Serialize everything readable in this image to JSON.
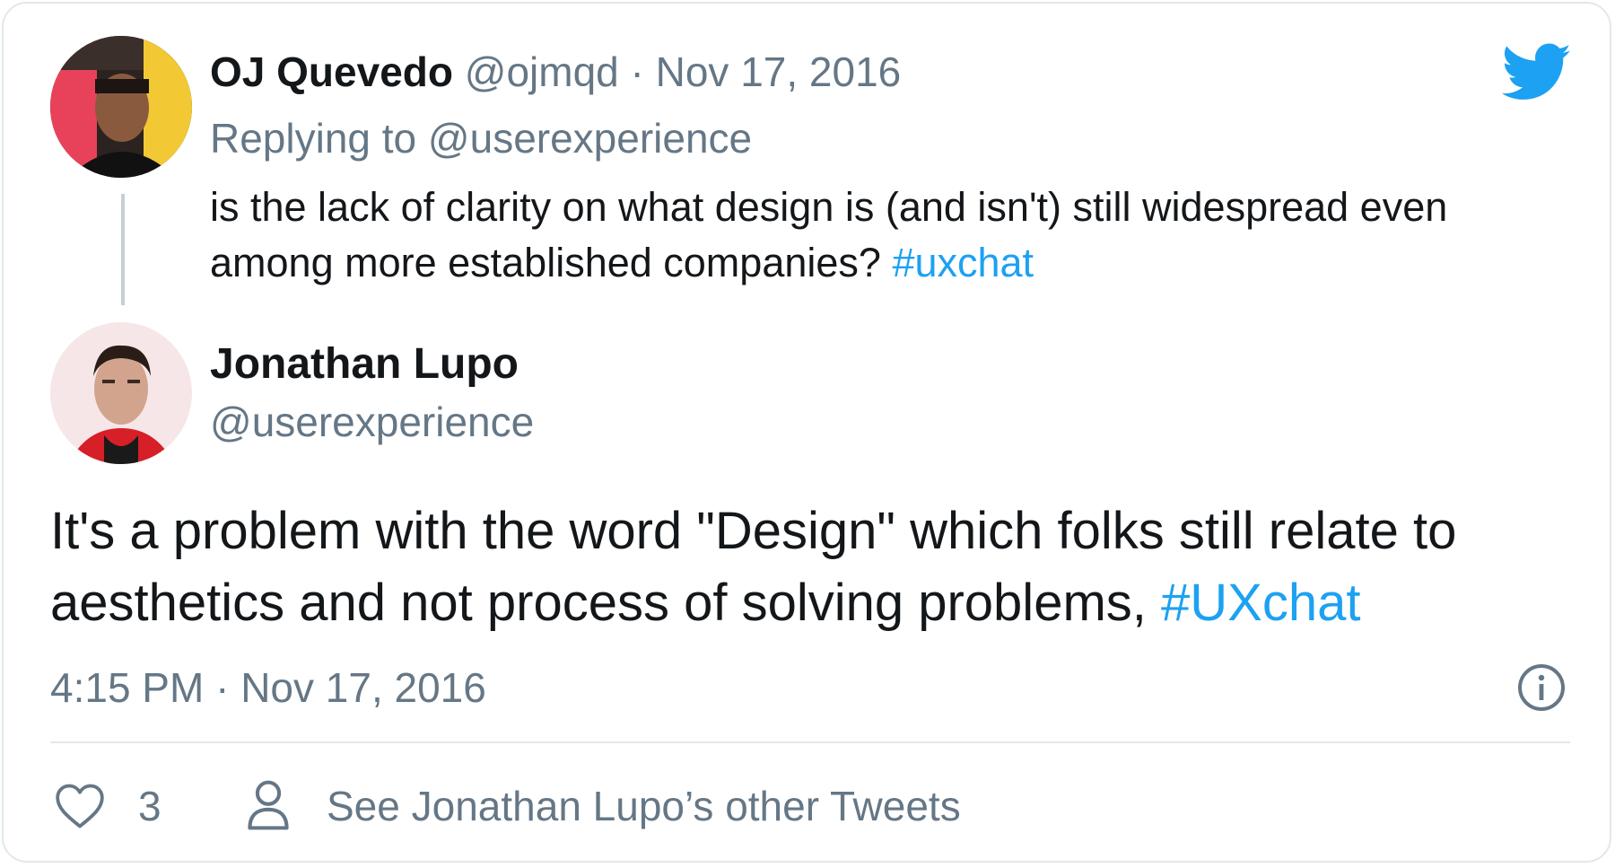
{
  "parent_tweet": {
    "author_name": "OJ Quevedo",
    "handle": "@ojmqd",
    "separator": "·",
    "date": "Nov 17, 2016",
    "replying_prefix": "Replying to",
    "replying_handle": "@userexperience",
    "text": "is the lack of clarity on what design is (and isn't) still widespread even among more established companies?",
    "hashtag": "#uxchat"
  },
  "main_tweet": {
    "author_name": "Jonathan Lupo",
    "handle": "@userexperience",
    "text": "It's a problem with the word \"Design\" which folks still relate to aesthetics and not process of solving problems,",
    "hashtag": "#UXchat",
    "timestamp": "4:15 PM · Nov 17, 2016"
  },
  "actions": {
    "like_icon": "heart-icon",
    "like_count": "3",
    "profile_icon": "person-icon",
    "other_tweets_label": "See Jonathan Lupo’s other Tweets",
    "info_icon": "info-icon"
  },
  "brand": {
    "logo_icon": "twitter-bird-icon",
    "accent_color": "#1da1f2",
    "muted_color": "#657786",
    "text_color": "#14171a",
    "border_color": "#e1e8ed"
  }
}
